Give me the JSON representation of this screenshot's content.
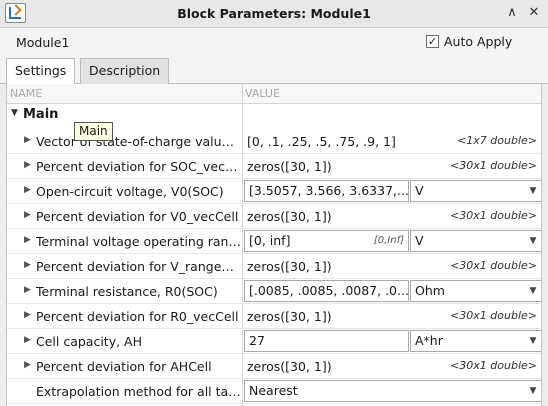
{
  "window": {
    "title": "Block Parameters: Module1",
    "icon": "simulink-block-icon",
    "buttons": {
      "minimize": "∧",
      "close": "✕"
    }
  },
  "header": {
    "block_name": "Module1",
    "auto_apply_label": "Auto Apply",
    "auto_apply_checked": "✓"
  },
  "tabs": [
    {
      "label": "Settings",
      "active": true
    },
    {
      "label": "Description",
      "active": false
    }
  ],
  "grid": {
    "col_name": "NAME",
    "col_value": "VALUE",
    "group": {
      "label": "Main",
      "expanded": true
    },
    "tooltip": "Main",
    "rows": [
      {
        "name": "Vector of state-of-charge values, SOC_vec",
        "value": "[0, .1, .25, .5, .75, .9, 1]",
        "dims": "<1x7 double>"
      },
      {
        "name": "Percent deviation for SOC_vecCell",
        "value": "zeros([30, 1])",
        "dims": "<30x1 double>"
      },
      {
        "name": "Open-circuit voltage, V0(SOC)",
        "value": "[3.5057, 3.566, 3.6337,...",
        "unit": "V"
      },
      {
        "name": "Percent deviation for V0_vecCell",
        "value": "zeros([30, 1])",
        "dims": "<30x1 double>"
      },
      {
        "name": "Terminal voltage operating range",
        "value": "[0, inf]",
        "hint": "[0,Inf]",
        "unit": "V"
      },
      {
        "name": "Percent deviation for V_rangeCell",
        "value": "zeros([30, 1])",
        "dims": "<30x1 double>"
      },
      {
        "name": "Terminal resistance, R0(SOC)",
        "value": "[.0085, .0085, .0087, .0...",
        "unit": "Ohm"
      },
      {
        "name": "Percent deviation for R0_vecCell",
        "value": "zeros([30, 1])",
        "dims": "<30x1 double>"
      },
      {
        "name": "Cell capacity, AH",
        "value": "27",
        "unit": "A*hr"
      },
      {
        "name": "Percent deviation for AHCell",
        "value": "zeros([30, 1])",
        "dims": "<30x1 double>"
      },
      {
        "name": "Extrapolation method for all tables",
        "value": "Nearest"
      }
    ]
  }
}
